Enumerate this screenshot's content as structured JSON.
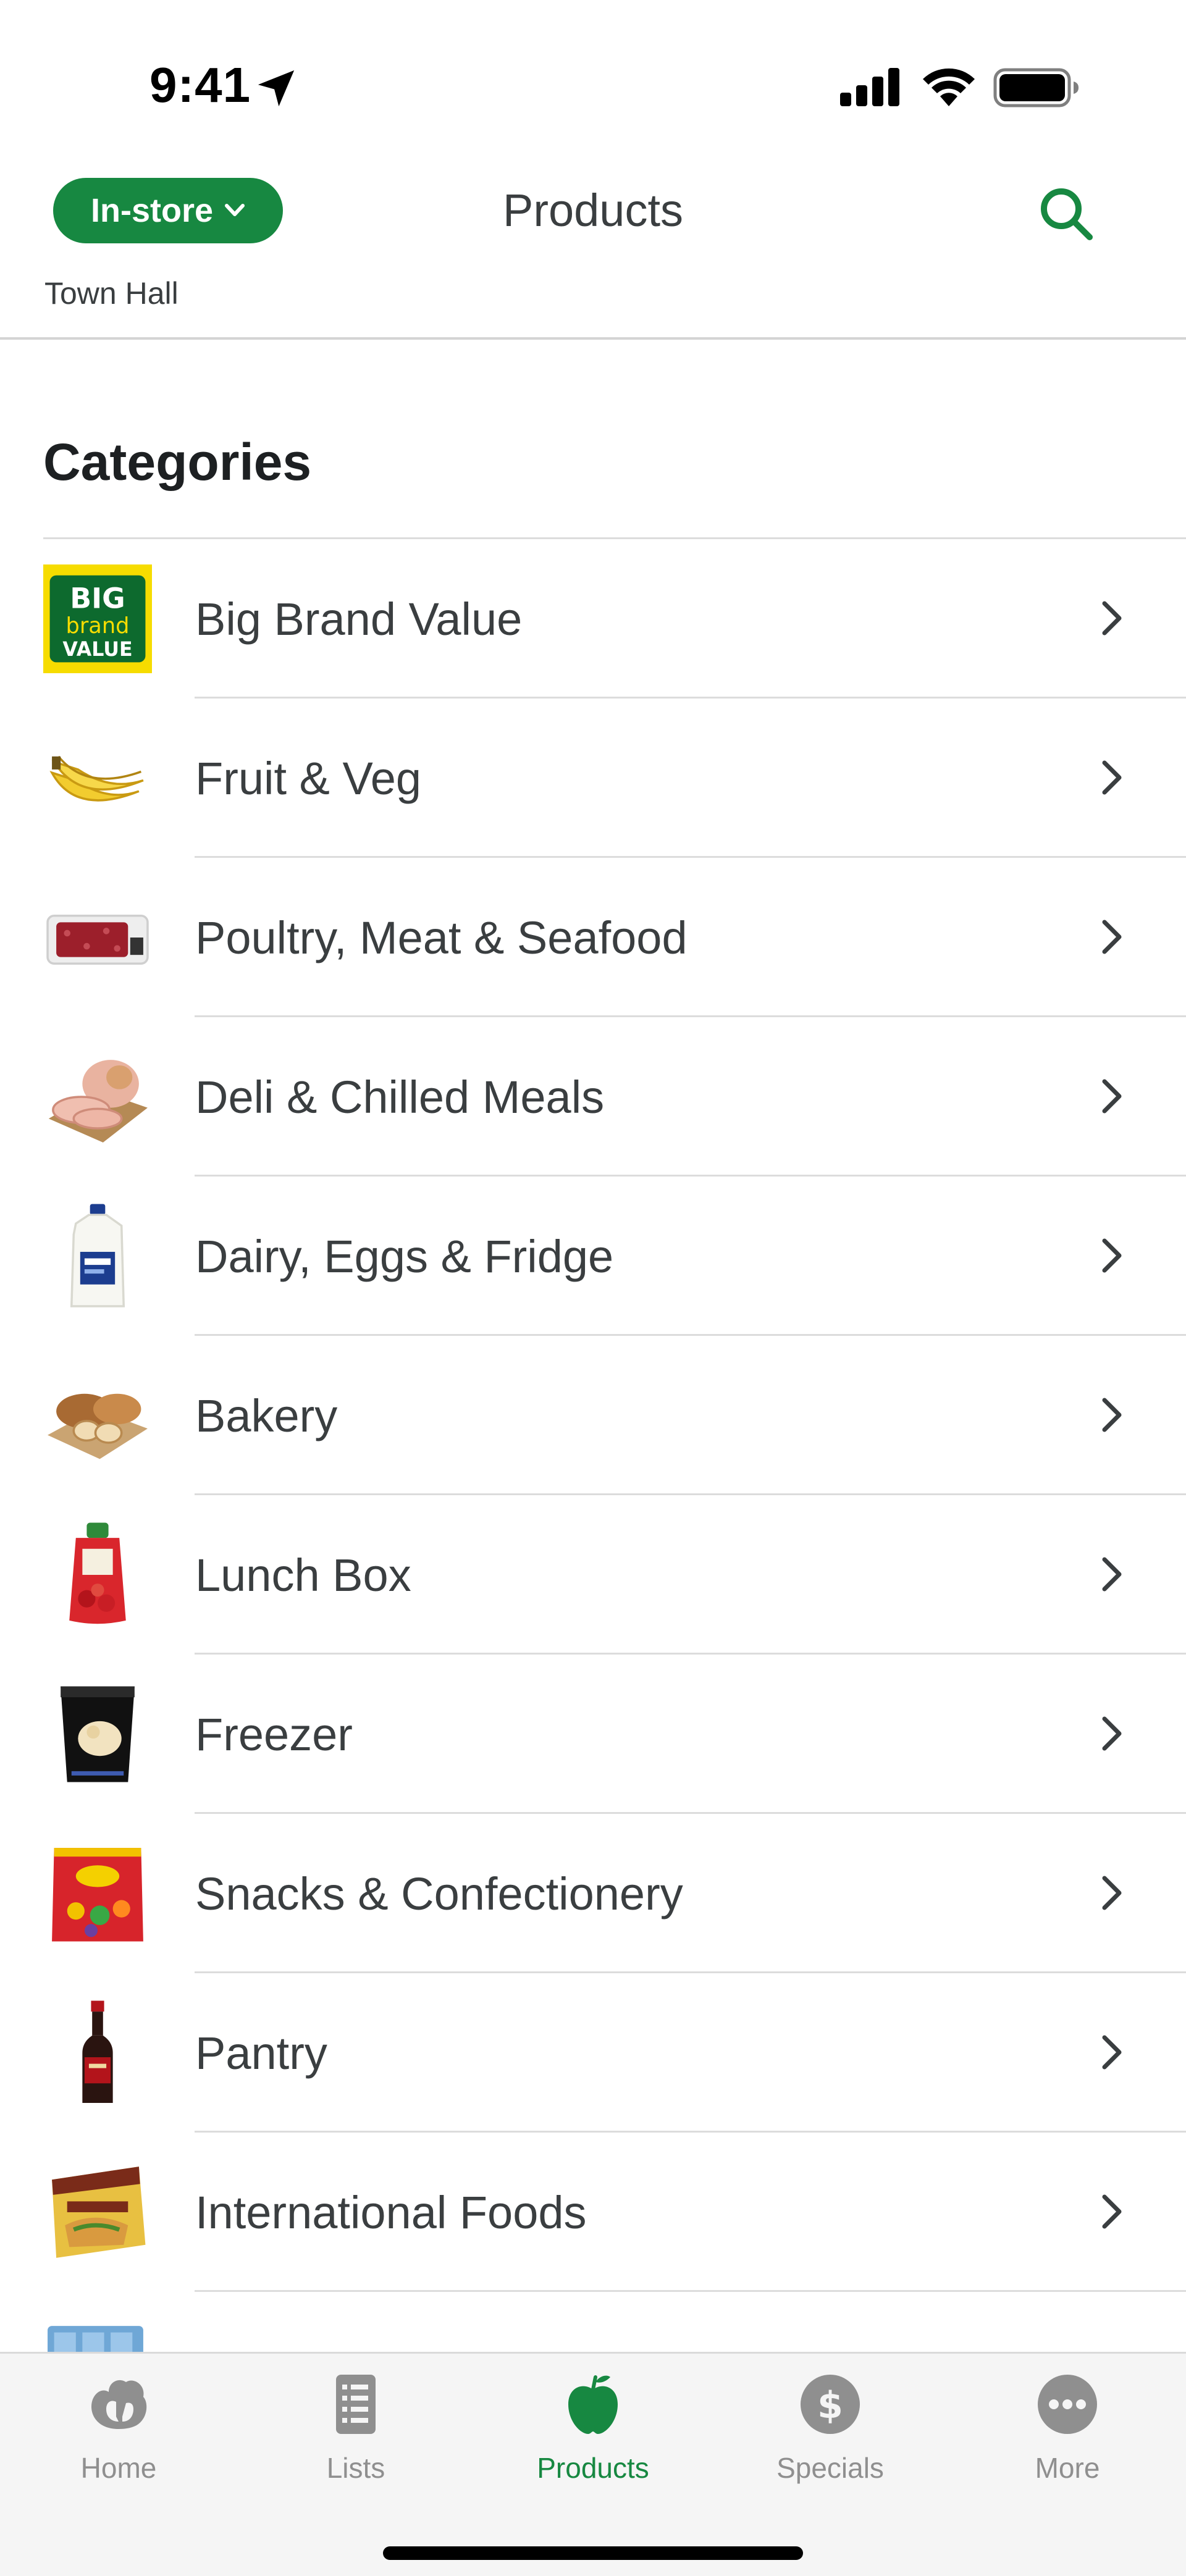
{
  "status_bar": {
    "time": "9:41"
  },
  "header": {
    "mode": "In-store",
    "title": "Products",
    "store": "Town Hall"
  },
  "categories": {
    "heading": "Categories",
    "items": [
      {
        "label": "Big Brand Value",
        "icon": "big-brand-value-logo"
      },
      {
        "label": "Fruit & Veg",
        "icon": "bananas-image"
      },
      {
        "label": "Poultry, Meat & Seafood",
        "icon": "mince-tray-image"
      },
      {
        "label": "Deli & Chilled Meals",
        "icon": "ham-image"
      },
      {
        "label": "Dairy, Eggs & Fridge",
        "icon": "milk-bottle-image"
      },
      {
        "label": "Bakery",
        "icon": "bread-image"
      },
      {
        "label": "Lunch Box",
        "icon": "fruit-pouch-image"
      },
      {
        "label": "Freezer",
        "icon": "ice-cream-tub-image"
      },
      {
        "label": "Snacks & Confectionery",
        "icon": "lolly-bag-image"
      },
      {
        "label": "Pantry",
        "icon": "sauce-bottle-image"
      },
      {
        "label": "International Foods",
        "icon": "taco-kit-image"
      }
    ]
  },
  "tabs": [
    {
      "label": "Home",
      "icon": "woolworths-logo-icon"
    },
    {
      "label": "Lists",
      "icon": "list-icon"
    },
    {
      "label": "Products",
      "icon": "apple-icon",
      "active": true
    },
    {
      "label": "Specials",
      "icon": "dollar-icon"
    },
    {
      "label": "More",
      "icon": "more-icon"
    }
  ],
  "colors": {
    "brand_green": "#178841",
    "tab_inactive": "#8f8f8f",
    "text": "#3a3e40"
  }
}
